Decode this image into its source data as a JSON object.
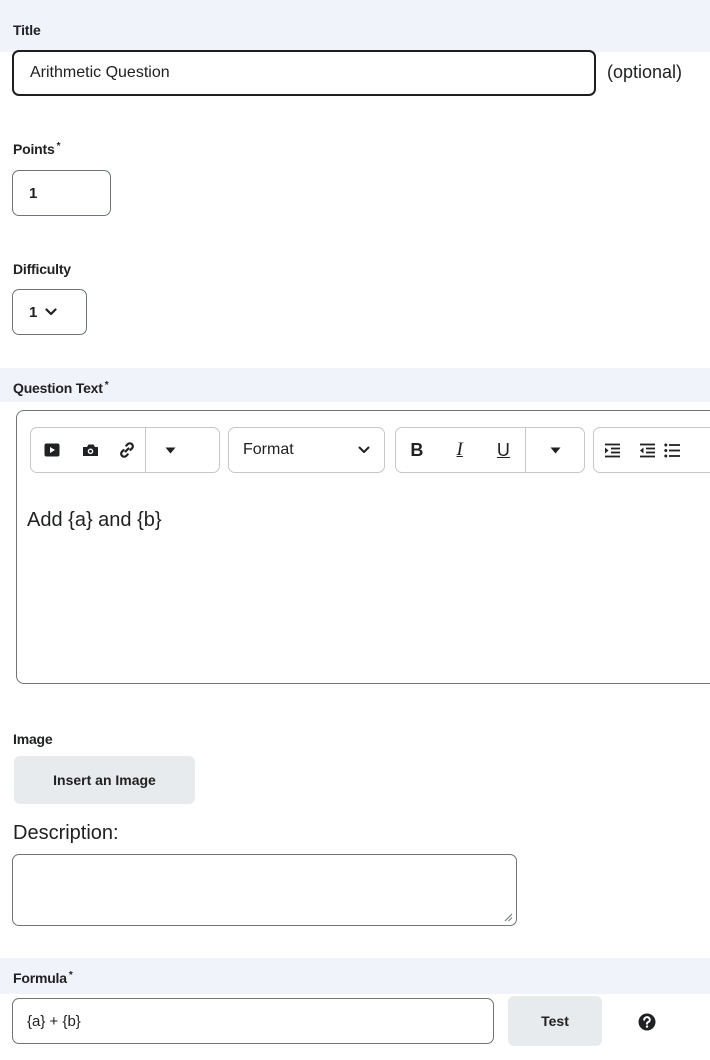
{
  "title_field": {
    "label": "Title",
    "value": "Arithmetic Question",
    "hint": "(optional)"
  },
  "points_field": {
    "label": "Points",
    "required_mark": "*",
    "value": "1"
  },
  "difficulty_field": {
    "label": "Difficulty",
    "selected": "1"
  },
  "question_text": {
    "label": "Question Text",
    "required_mark": "*",
    "toolbar": {
      "format_label": "Format",
      "bold": "B",
      "italic": "I",
      "underline": "U"
    },
    "content": "Add {a} and {b}"
  },
  "image_section": {
    "label": "Image",
    "insert_button": "Insert an Image"
  },
  "description": {
    "label": "Description:",
    "value": ""
  },
  "formula": {
    "label": "Formula",
    "required_mark": "*",
    "value": "{a} + {b}",
    "test_button": "Test"
  }
}
